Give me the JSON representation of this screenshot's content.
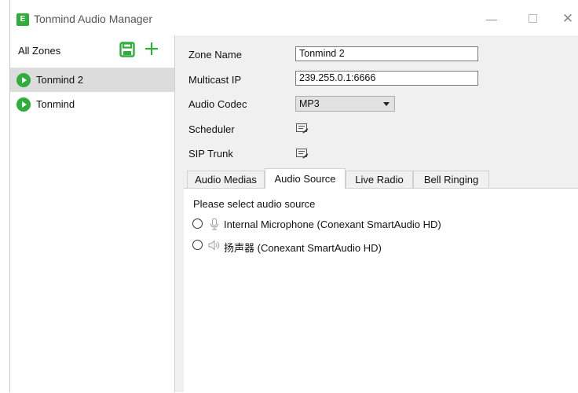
{
  "window": {
    "title": "Tonmind Audio Manager",
    "icon_text": "E"
  },
  "sidebar": {
    "header": "All Zones",
    "zones": [
      {
        "label": "Tonmind 2",
        "selected": true
      },
      {
        "label": "Tonmind",
        "selected": false
      }
    ]
  },
  "form": {
    "zone_name_label": "Zone Name",
    "zone_name_value": "Tonmind 2",
    "multicast_ip_label": "Multicast IP",
    "multicast_ip_value": "239.255.0.1:6666",
    "audio_codec_label": "Audio Codec",
    "audio_codec_value": "MP3",
    "scheduler_label": "Scheduler",
    "sip_trunk_label": "SIP Trunk"
  },
  "tabs": [
    {
      "label": "Audio Medias",
      "active": false
    },
    {
      "label": "Audio Source",
      "active": true
    },
    {
      "label": "Live Radio",
      "active": false
    },
    {
      "label": "Bell Ringing",
      "active": false
    }
  ],
  "audio_source": {
    "prompt": "Please select audio source",
    "options": [
      {
        "label": "Internal Microphone (Conexant SmartAudio HD)",
        "icon": "microphone-icon",
        "selected": false
      },
      {
        "label": "扬声器 (Conexant SmartAudio HD)",
        "icon": "speaker-icon",
        "selected": false
      }
    ]
  },
  "colors": {
    "accent_green": "#2fae3b",
    "selected_row": "#dcdcdc"
  }
}
